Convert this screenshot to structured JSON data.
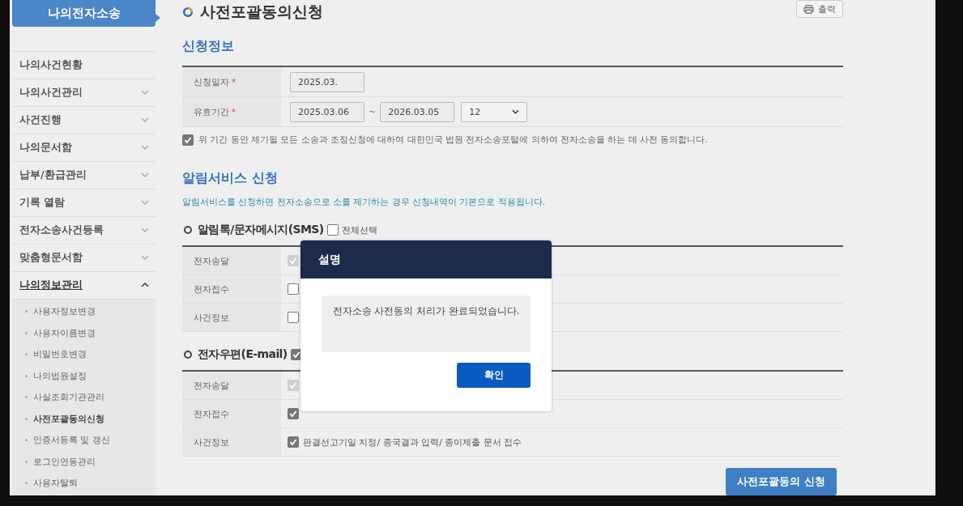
{
  "sidebar": {
    "title": "나의전자소송",
    "items": [
      {
        "label": "나의사건현황",
        "kind": "link",
        "expanded": false,
        "selected": false
      },
      {
        "label": "나의사건관리",
        "kind": "group",
        "expanded": false,
        "selected": false
      },
      {
        "label": "사건진행",
        "kind": "group",
        "expanded": false,
        "selected": false
      },
      {
        "label": "나의문서함",
        "kind": "group",
        "expanded": false,
        "selected": false
      },
      {
        "label": "납부/환급관리",
        "kind": "group",
        "expanded": false,
        "selected": false
      },
      {
        "label": "기록 열람",
        "kind": "group",
        "expanded": false,
        "selected": false
      },
      {
        "label": "전자소송사건등록",
        "kind": "group",
        "expanded": false,
        "selected": false
      },
      {
        "label": "맞춤형문서함",
        "kind": "group",
        "expanded": false,
        "selected": false
      },
      {
        "label": "나의정보관리",
        "kind": "group",
        "expanded": true,
        "selected": true,
        "children": [
          {
            "label": "사용자정보변경",
            "selected": false
          },
          {
            "label": "사용자이름변경",
            "selected": false
          },
          {
            "label": "비밀번호변경",
            "selected": false
          },
          {
            "label": "나의법원설정",
            "selected": false
          },
          {
            "label": "사실조회기관관리",
            "selected": false
          },
          {
            "label": "사전포괄동의신청",
            "selected": true
          },
          {
            "label": "인증서등록 및 갱신",
            "selected": false
          },
          {
            "label": "로그인연동관리",
            "selected": false
          },
          {
            "label": "사용자탈퇴",
            "selected": false
          }
        ]
      }
    ]
  },
  "page": {
    "title": "사전포괄동의신청",
    "print_button": "출력"
  },
  "application_info": {
    "heading": "신청정보",
    "rows": [
      {
        "label": "신청일자",
        "required_mark": "*",
        "kind": "date",
        "value": "2025.03."
      },
      {
        "label": "유효기간",
        "required_mark": "*",
        "kind": "range",
        "from": "2025.03.06",
        "separator": "~",
        "to": "2026.03.05",
        "select": "12"
      }
    ],
    "consent": {
      "checked": true,
      "text": "위 기간 동안 제기될 모든 소송과 조정신청에 대하여 대한민국 법원 전자소송포털에 의하여 전자소송을 하는 데 사전 동의합니다."
    }
  },
  "notification": {
    "heading": "알림서비스 신청",
    "note": "알림서비스를 신청하면 전자소송으로 소를 제기하는 경우 신청내역이 기본으로 적용됩니다.",
    "groups": [
      {
        "title": "알림톡/문자메시지(SMS)",
        "select_all": {
          "checked": false,
          "label": "전체선택"
        },
        "rows": [
          {
            "label": "전자송달",
            "checked": true,
            "disabled": true
          },
          {
            "label": "전자접수",
            "checked": false,
            "disabled": false
          },
          {
            "label": "사건정보",
            "checked": false,
            "disabled": false
          }
        ]
      },
      {
        "title": "전자우편(E-mail)",
        "select_all": {
          "checked": true
        },
        "rows": [
          {
            "label": "전자송달",
            "checked": true,
            "disabled": true
          },
          {
            "label": "전자접수",
            "checked": true,
            "disabled": false
          },
          {
            "label": "사건정보",
            "checked": true,
            "disabled": false,
            "text": "판결선고기일 지정/ 종국결과 입력/ 종이제출 문서 접수"
          }
        ]
      }
    ],
    "submit_button": "사전포괄동의 신청"
  },
  "dialog": {
    "title": "설명",
    "message": "전자소송 사전동의 처리가 완료되었습니다.",
    "button": "확인"
  }
}
